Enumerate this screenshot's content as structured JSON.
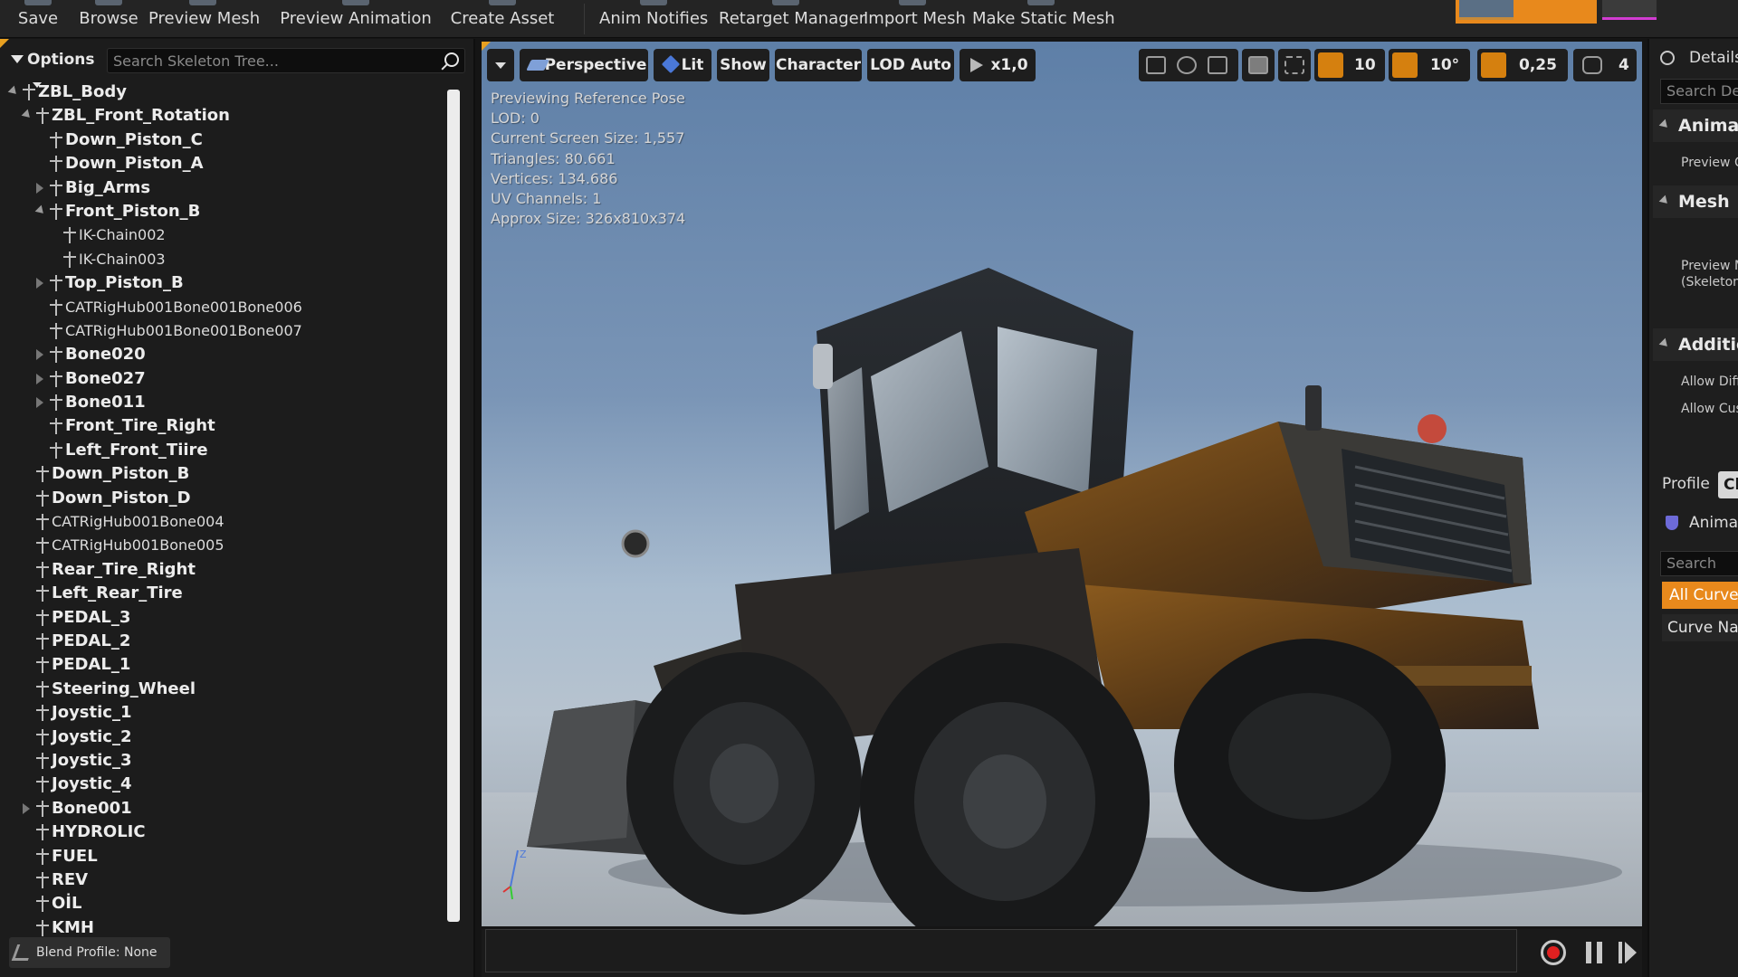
{
  "toolbar": {
    "buttons": [
      {
        "label": "Save",
        "icon": "save-icon"
      },
      {
        "label": "Browse",
        "icon": "browse-icon"
      },
      {
        "label": "Preview Mesh",
        "icon": "mesh-icon"
      },
      {
        "label": "Preview Animation",
        "icon": "animation-icon"
      },
      {
        "label": "Create Asset",
        "icon": "create-asset-icon"
      },
      {
        "label": "Anim Notifies",
        "icon": "notifies-icon"
      },
      {
        "label": "Retarget Manager",
        "icon": "retarget-icon"
      },
      {
        "label": "Import Mesh",
        "icon": "import-icon"
      },
      {
        "label": "Make Static Mesh",
        "icon": "static-mesh-icon"
      }
    ]
  },
  "skeleton_tree": {
    "options_label": "Options",
    "search_placeholder": "Search Skeleton Tree...",
    "bones": [
      {
        "name": "ZBL_Body",
        "depth": 0,
        "expander": "open"
      },
      {
        "name": "ZBL_Front_Rotation",
        "depth": 1,
        "expander": "open"
      },
      {
        "name": "Down_Piston_C",
        "depth": 2,
        "expander": "none"
      },
      {
        "name": "Down_Piston_A",
        "depth": 2,
        "expander": "none"
      },
      {
        "name": "Big_Arms",
        "depth": 2,
        "expander": "closed"
      },
      {
        "name": "Front_Piston_B",
        "depth": 2,
        "expander": "open"
      },
      {
        "name": "IK-Chain002",
        "depth": 3,
        "expander": "none",
        "small": true
      },
      {
        "name": "IK-Chain003",
        "depth": 3,
        "expander": "none",
        "small": true
      },
      {
        "name": "Top_Piston_B",
        "depth": 2,
        "expander": "closed"
      },
      {
        "name": "CATRigHub001Bone001Bone006",
        "depth": 2,
        "expander": "none",
        "small": true
      },
      {
        "name": "CATRigHub001Bone001Bone007",
        "depth": 2,
        "expander": "none",
        "small": true
      },
      {
        "name": "Bone020",
        "depth": 2,
        "expander": "closed"
      },
      {
        "name": "Bone027",
        "depth": 2,
        "expander": "closed"
      },
      {
        "name": "Bone011",
        "depth": 2,
        "expander": "closed"
      },
      {
        "name": "Front_Tire_Right",
        "depth": 2,
        "expander": "none"
      },
      {
        "name": "Left_Front_Tiire",
        "depth": 2,
        "expander": "none"
      },
      {
        "name": "Down_Piston_B",
        "depth": 1,
        "expander": "none"
      },
      {
        "name": "Down_Piston_D",
        "depth": 1,
        "expander": "none"
      },
      {
        "name": "CATRigHub001Bone004",
        "depth": 1,
        "expander": "none",
        "small": true
      },
      {
        "name": "CATRigHub001Bone005",
        "depth": 1,
        "expander": "none",
        "small": true
      },
      {
        "name": "Rear_Tire_Right",
        "depth": 1,
        "expander": "none"
      },
      {
        "name": "Left_Rear_Tire",
        "depth": 1,
        "expander": "none"
      },
      {
        "name": "PEDAL_3",
        "depth": 1,
        "expander": "none"
      },
      {
        "name": "PEDAL_2",
        "depth": 1,
        "expander": "none"
      },
      {
        "name": "PEDAL_1",
        "depth": 1,
        "expander": "none"
      },
      {
        "name": "Steering_Wheel",
        "depth": 1,
        "expander": "none"
      },
      {
        "name": "Joystic_1",
        "depth": 1,
        "expander": "none"
      },
      {
        "name": "Joystic_2",
        "depth": 1,
        "expander": "none"
      },
      {
        "name": "Joystic_3",
        "depth": 1,
        "expander": "none"
      },
      {
        "name": "Joystic_4",
        "depth": 1,
        "expander": "none"
      },
      {
        "name": "Bone001",
        "depth": 1,
        "expander": "closed"
      },
      {
        "name": "HYDROLIC",
        "depth": 1,
        "expander": "none"
      },
      {
        "name": "FUEL",
        "depth": 1,
        "expander": "none"
      },
      {
        "name": "REV",
        "depth": 1,
        "expander": "none"
      },
      {
        "name": "OİL",
        "depth": 1,
        "expander": "none"
      },
      {
        "name": "KMH",
        "depth": 1,
        "expander": "none"
      }
    ],
    "blend_profile_label": "Blend Profile: None"
  },
  "viewport": {
    "perspective_label": "Perspective",
    "lit_label": "Lit",
    "show_label": "Show",
    "character_label": "Character",
    "lod_label": "LOD Auto",
    "play_rate_label": "x1,0",
    "grid_snap_value": "10",
    "rotation_snap_value": "10°",
    "scale_snap_value": "0,25",
    "camera_speed_value": "4",
    "stats": [
      "Previewing Reference Pose",
      "LOD: 0",
      "Current Screen Size: 1,557",
      "Triangles: 80.661",
      "Vertices: 134.686",
      "UV Channels: 1",
      "Approx Size: 326x810x374"
    ],
    "axis_label": "Z",
    "colors": {
      "accent_orange": "#e8891c",
      "lit_cube_blue": "#4a78d8",
      "record_red": "#e02020"
    }
  },
  "details": {
    "tab_label": "Details",
    "search_placeholder": "Search Details",
    "categories": [
      {
        "label": "Animation",
        "rows": [
          "Preview C"
        ]
      },
      {
        "label": "Mesh",
        "rows": [
          "Preview M",
          "(Skeleton)"
        ]
      },
      {
        "label": "Additional",
        "rows": [
          "Allow Diff",
          "Allow Cus"
        ]
      }
    ],
    "profile_label": "Profile",
    "profile_button": "Cle",
    "anim_curves_tab": "Anima",
    "curves_search_placeholder": "Search",
    "all_curves_label": "All Curves",
    "curve_name_header": "Curve Nam"
  }
}
